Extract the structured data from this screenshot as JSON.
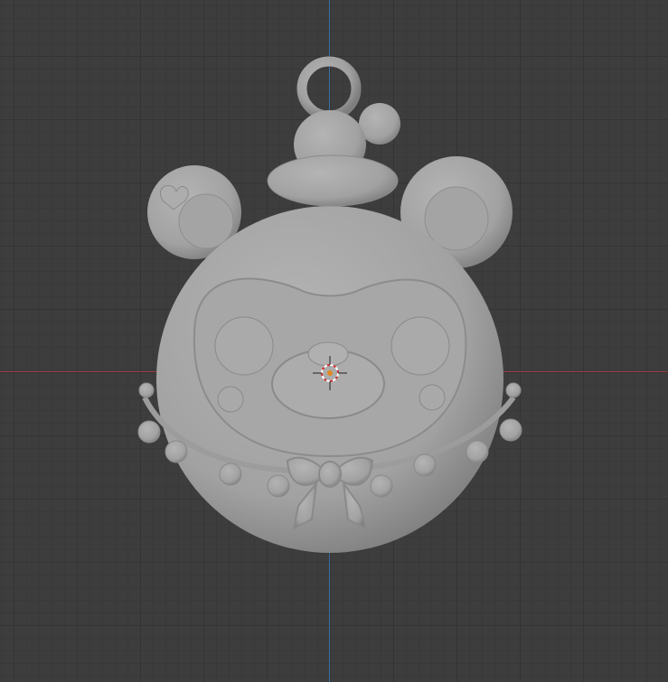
{
  "viewport": {
    "background_color": "#3d3d3d",
    "x_axis_color": "#9a3b44",
    "y_axis_color": "#3b6ea3",
    "model_color": "#a8a8a8",
    "cursor_icon": "3d-cursor-icon"
  }
}
